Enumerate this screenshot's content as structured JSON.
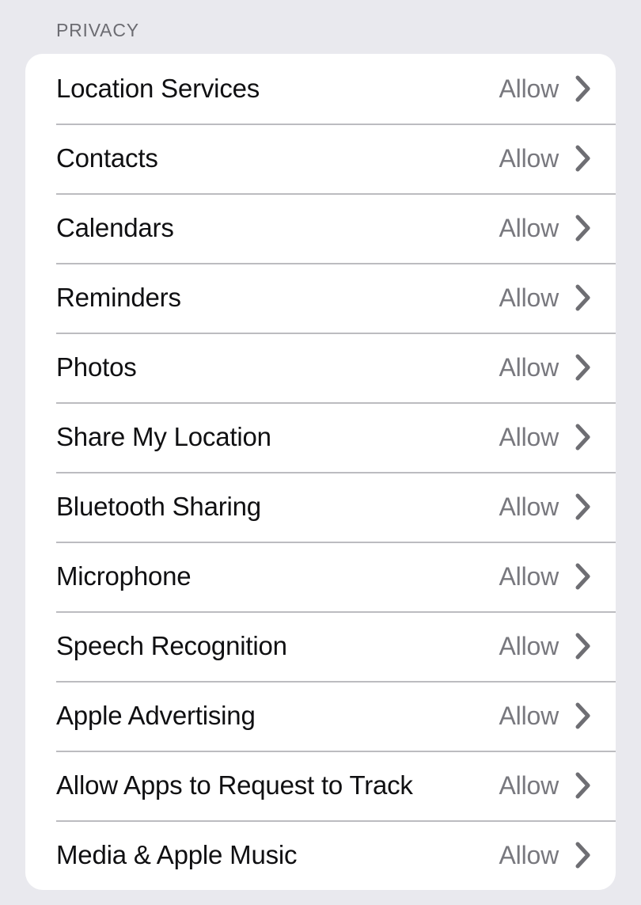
{
  "section": {
    "header": "PRIVACY"
  },
  "colors": {
    "background": "#e9e9ee",
    "card": "#ffffff",
    "label_text": "#101012",
    "value_text": "#78787e",
    "header_text": "#6c6c72",
    "separator": "#bcbcc0",
    "chevron": "#6e6e73"
  },
  "rows": [
    {
      "label": "Location Services",
      "value": "Allow",
      "accessory": "chevron-right-icon"
    },
    {
      "label": "Contacts",
      "value": "Allow",
      "accessory": "chevron-right-icon"
    },
    {
      "label": "Calendars",
      "value": "Allow",
      "accessory": "chevron-right-icon"
    },
    {
      "label": "Reminders",
      "value": "Allow",
      "accessory": "chevron-right-icon"
    },
    {
      "label": "Photos",
      "value": "Allow",
      "accessory": "chevron-right-icon"
    },
    {
      "label": "Share My Location",
      "value": "Allow",
      "accessory": "chevron-right-icon"
    },
    {
      "label": "Bluetooth Sharing",
      "value": "Allow",
      "accessory": "chevron-right-icon"
    },
    {
      "label": "Microphone",
      "value": "Allow",
      "accessory": "chevron-right-icon"
    },
    {
      "label": "Speech Recognition",
      "value": "Allow",
      "accessory": "chevron-right-icon"
    },
    {
      "label": "Apple Advertising",
      "value": "Allow",
      "accessory": "chevron-right-icon"
    },
    {
      "label": "Allow Apps to Request to Track",
      "value": "Allow",
      "accessory": "chevron-right-icon"
    },
    {
      "label": "Media & Apple Music",
      "value": "Allow",
      "accessory": "chevron-right-icon"
    }
  ]
}
